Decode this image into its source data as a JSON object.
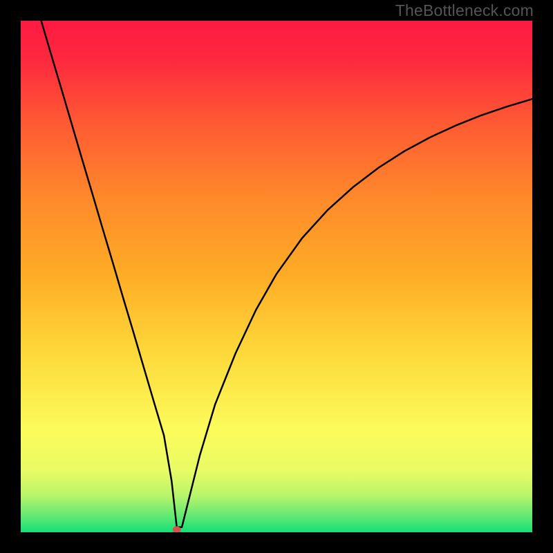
{
  "watermark": "TheBottleneck.com",
  "chart_data": {
    "type": "line",
    "title": "",
    "xlabel": "",
    "ylabel": "",
    "xlim": [
      0,
      100
    ],
    "ylim": [
      0,
      100
    ],
    "gradient_colors": {
      "top": "#fd1a42",
      "mid_upper": "#fead26",
      "mid_lower": "#fbfc5b",
      "bottom": "#13e077"
    },
    "series": [
      {
        "name": "bottleneck-curve",
        "color": "#000000",
        "x": [
          4,
          6,
          8,
          10,
          12,
          14,
          16,
          18,
          20,
          22,
          24,
          26,
          28,
          29.5,
          30.5,
          31.5,
          33,
          35,
          38,
          42,
          46,
          50,
          55,
          60,
          65,
          70,
          75,
          80,
          85,
          90,
          95,
          100
        ],
        "y": [
          100,
          93.2,
          86.5,
          79.7,
          72.9,
          66.2,
          59.4,
          52.7,
          45.9,
          39.2,
          32.4,
          25.6,
          18.9,
          10.0,
          1.0,
          1.0,
          7.0,
          15.0,
          25.0,
          35.0,
          43.5,
          50.5,
          57.5,
          63.0,
          67.5,
          71.3,
          74.5,
          77.2,
          79.5,
          81.5,
          83.2,
          84.7
        ]
      }
    ],
    "marker": {
      "x": 30.5,
      "y": 0.5,
      "color": "#d9524a",
      "radius": 6
    }
  }
}
